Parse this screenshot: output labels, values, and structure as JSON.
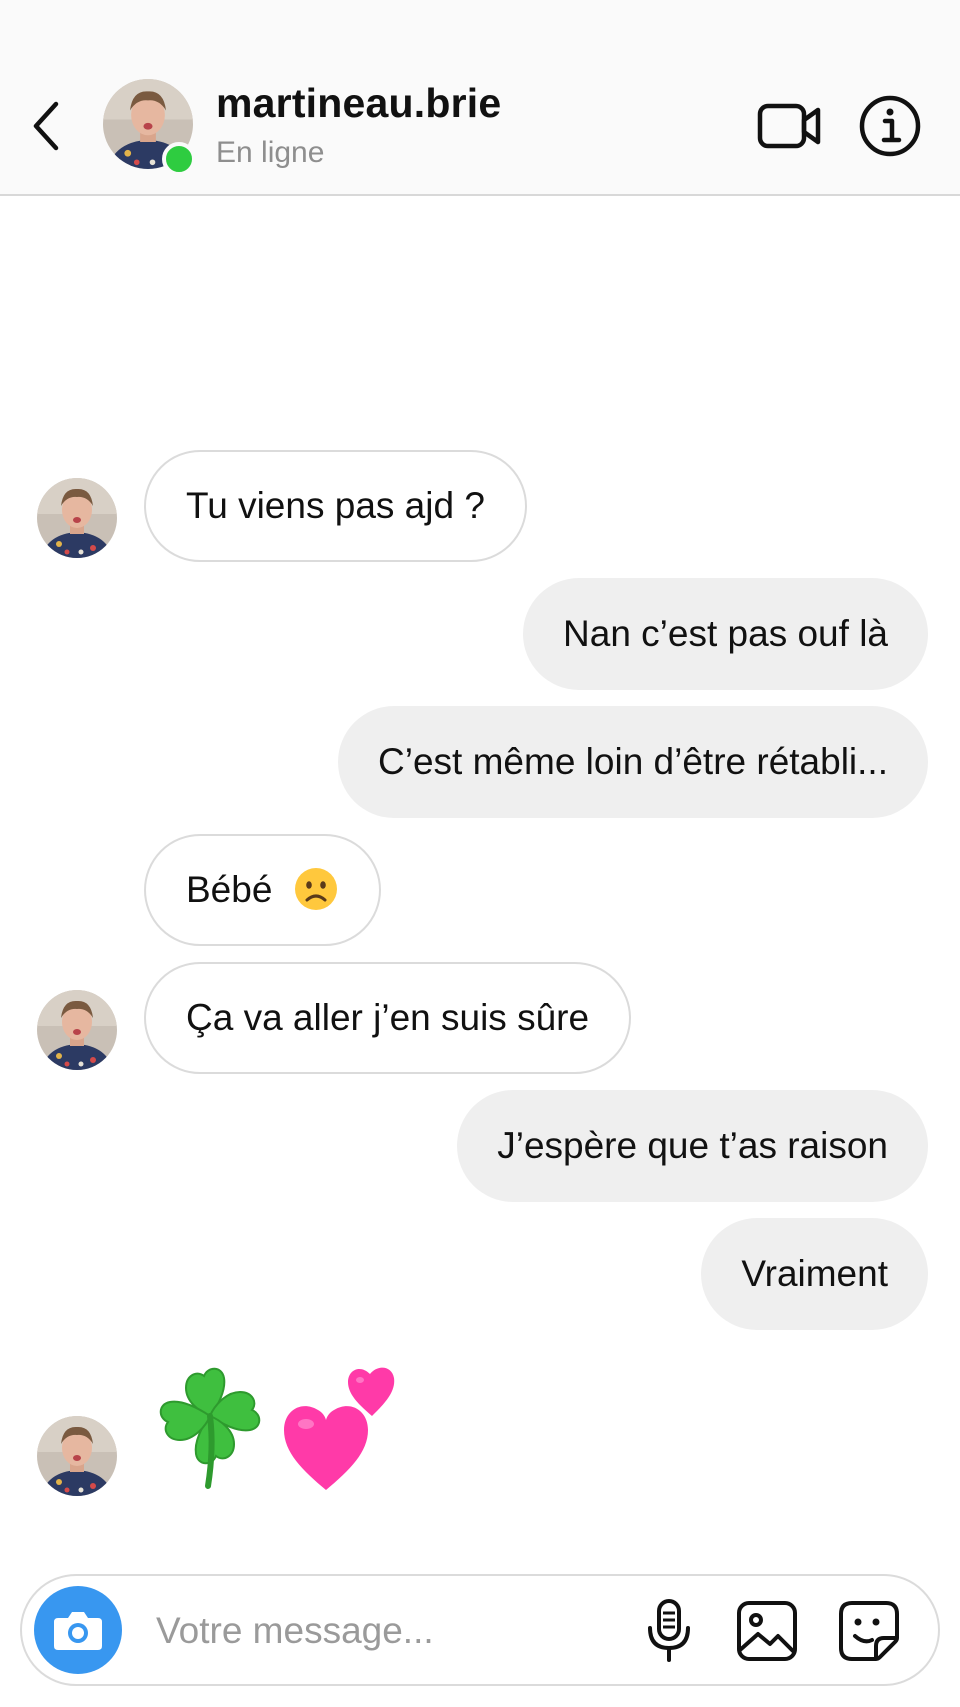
{
  "header": {
    "username": "martineau.brie",
    "status": "En ligne"
  },
  "messages": [
    {
      "direction": "in",
      "text": "Tu viens pas ajd ?"
    },
    {
      "direction": "out",
      "text": "Nan c’est pas ouf là"
    },
    {
      "direction": "out",
      "text": "C’est même loin d’être rétabli..."
    },
    {
      "direction": "in",
      "text": "Bébé",
      "emoji": "sad-face-icon"
    },
    {
      "direction": "in",
      "text": "Ça va aller j’en suis sûre"
    },
    {
      "direction": "out",
      "text": "J’espère que t’as raison"
    },
    {
      "direction": "out",
      "text": "Vraiment"
    },
    {
      "direction": "in",
      "emojis": [
        "four-leaf-clover-icon",
        "two-hearts-icon"
      ]
    }
  ],
  "composer": {
    "placeholder": "Votre message..."
  },
  "colors": {
    "online": "#2ecc40",
    "camera_button": "#3897f0",
    "outgoing_bubble": "#efefef",
    "incoming_bubble_border": "#dbdbdb",
    "heart": "#ff3aa8",
    "clover": "#3fbf3f",
    "sad_face": "#ffc83d"
  }
}
